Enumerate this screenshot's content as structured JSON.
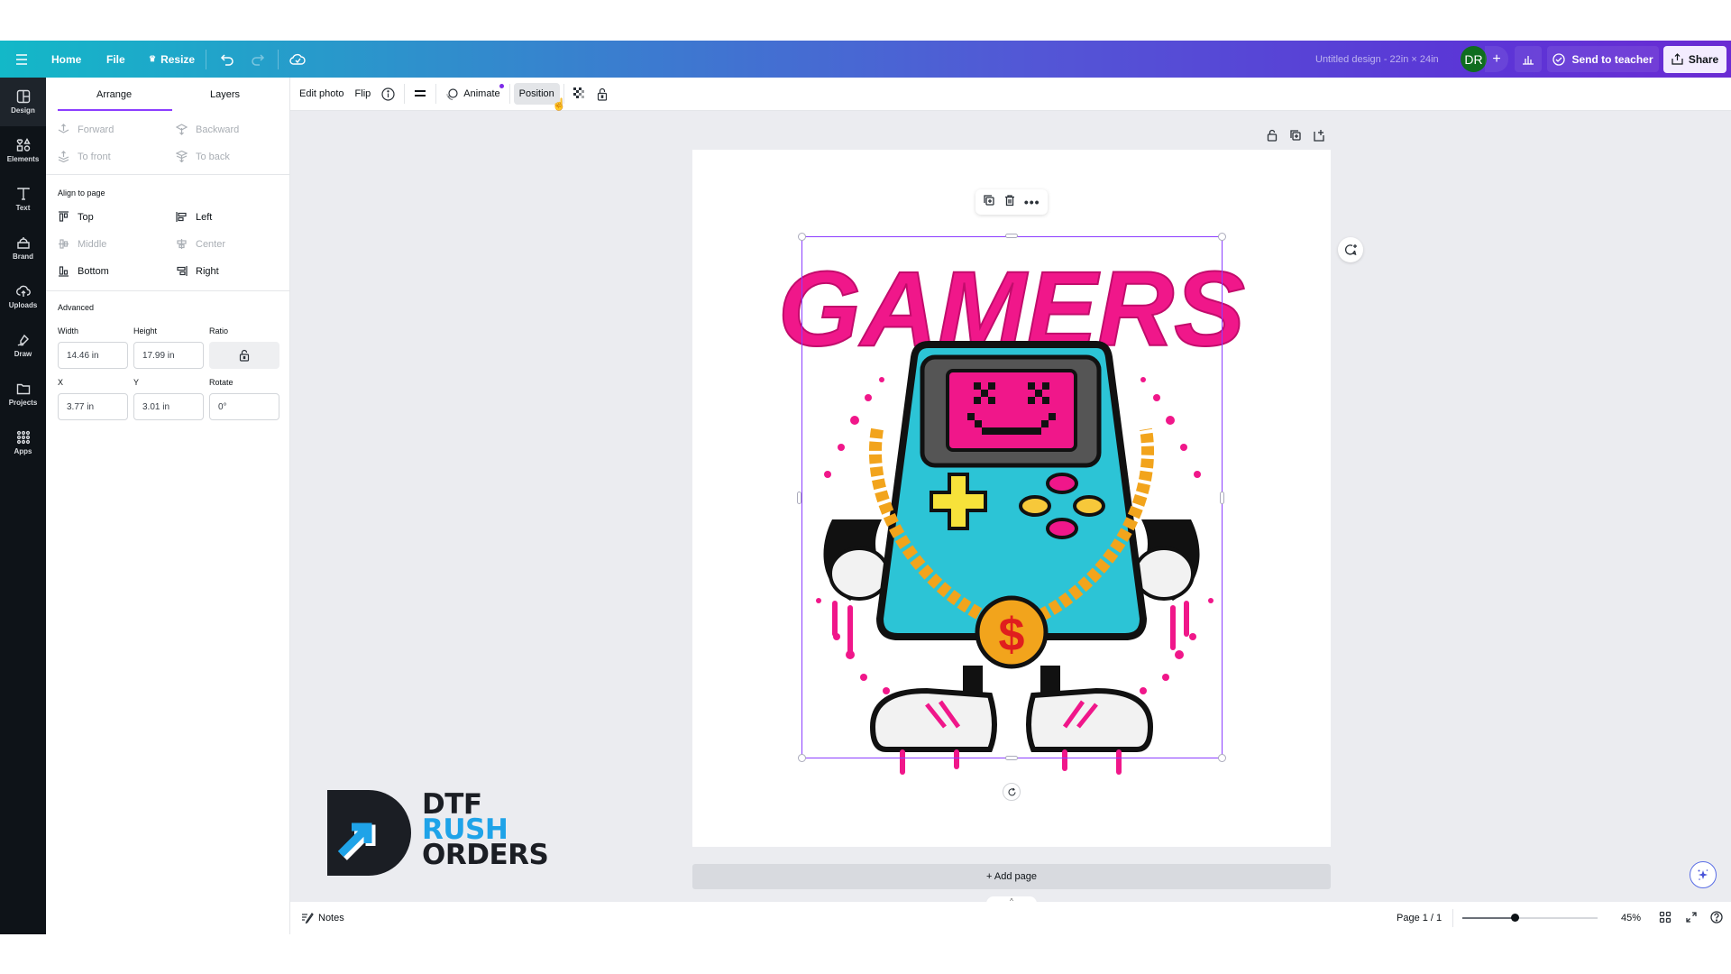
{
  "topbar": {
    "menu_icon": "hamburger-icon",
    "home": "Home",
    "file": "File",
    "resize": "Resize",
    "doc_title": "Untitled design - 22in × 24in",
    "avatar_initials": "DR",
    "avatar_color": "#0f6d1f",
    "send_to_teacher": "Send to teacher",
    "share": "Share"
  },
  "rail": [
    {
      "label": "Design",
      "icon": "layout-icon"
    },
    {
      "label": "Elements",
      "icon": "shapes-icon"
    },
    {
      "label": "Text",
      "icon": "text-icon"
    },
    {
      "label": "Brand",
      "icon": "brand-icon"
    },
    {
      "label": "Uploads",
      "icon": "cloud-upload-icon"
    },
    {
      "label": "Draw",
      "icon": "pen-icon"
    },
    {
      "label": "Projects",
      "icon": "folder-icon"
    },
    {
      "label": "Apps",
      "icon": "grid-icon"
    }
  ],
  "panel": {
    "tabs": [
      "Arrange",
      "Layers"
    ],
    "active_tab": "Arrange",
    "order": {
      "forward": "Forward",
      "backward": "Backward",
      "to_front": "To front",
      "to_back": "To back"
    },
    "align_heading": "Align to page",
    "align": {
      "top": "Top",
      "left": "Left",
      "middle": "Middle",
      "center": "Center",
      "bottom": "Bottom",
      "right": "Right"
    },
    "advanced_heading": "Advanced",
    "width_label": "Width",
    "width_value": "14.46 in",
    "height_label": "Height",
    "height_value": "17.99 in",
    "ratio_label": "Ratio",
    "x_label": "X",
    "x_value": "3.77 in",
    "y_label": "Y",
    "y_value": "3.01 in",
    "rotate_label": "Rotate",
    "rotate_value": "0°"
  },
  "context_toolbar": {
    "edit_photo": "Edit photo",
    "flip": "Flip",
    "animate": "Animate",
    "position": "Position"
  },
  "canvas": {
    "design_title_text": "GAMERS",
    "add_page": "+ Add page",
    "accent": "#8b3dff"
  },
  "watermark": {
    "line1": "DTF",
    "line2": "RUSH",
    "line3": "ORDERS"
  },
  "bottombar": {
    "notes": "Notes",
    "page_indicator": "Page 1 / 1",
    "zoom_percent": "45%",
    "zoom_fraction": 0.45
  }
}
